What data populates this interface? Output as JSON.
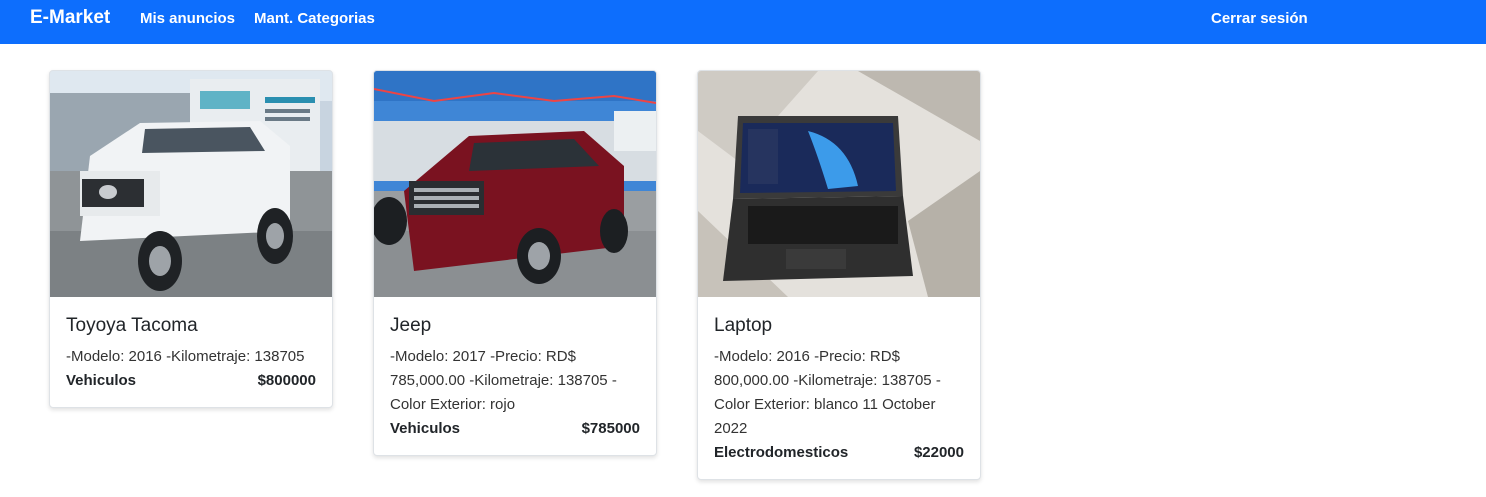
{
  "nav": {
    "brand": "E-Market",
    "links": [
      "Mis anuncios",
      "Mant. Categorias"
    ],
    "logout": "Cerrar sesión"
  },
  "cards": [
    {
      "title": "Toyoya Tacoma",
      "description": "-Modelo: 2016 -Kilometraje: 138705",
      "category": "Vehiculos",
      "price": "$800000",
      "image": "white pickup truck photo"
    },
    {
      "title": "Jeep",
      "description": "-Modelo: 2017 -Precio: RD$ 785,000.00 -Kilometraje: 138705 -Color Exterior: rojo",
      "category": "Vehiculos",
      "price": "$785000",
      "image": "red suv photo"
    },
    {
      "title": "Laptop",
      "description": "-Modelo: 2016 -Precio: RD$ 800,000.00 -Kilometraje: 138705 -Color Exterior: blanco 11 October 2022",
      "category": "Electrodomesticos",
      "price": "$22000",
      "image": "laptop photo"
    }
  ],
  "colors": {
    "primary": "#0d6efd"
  }
}
